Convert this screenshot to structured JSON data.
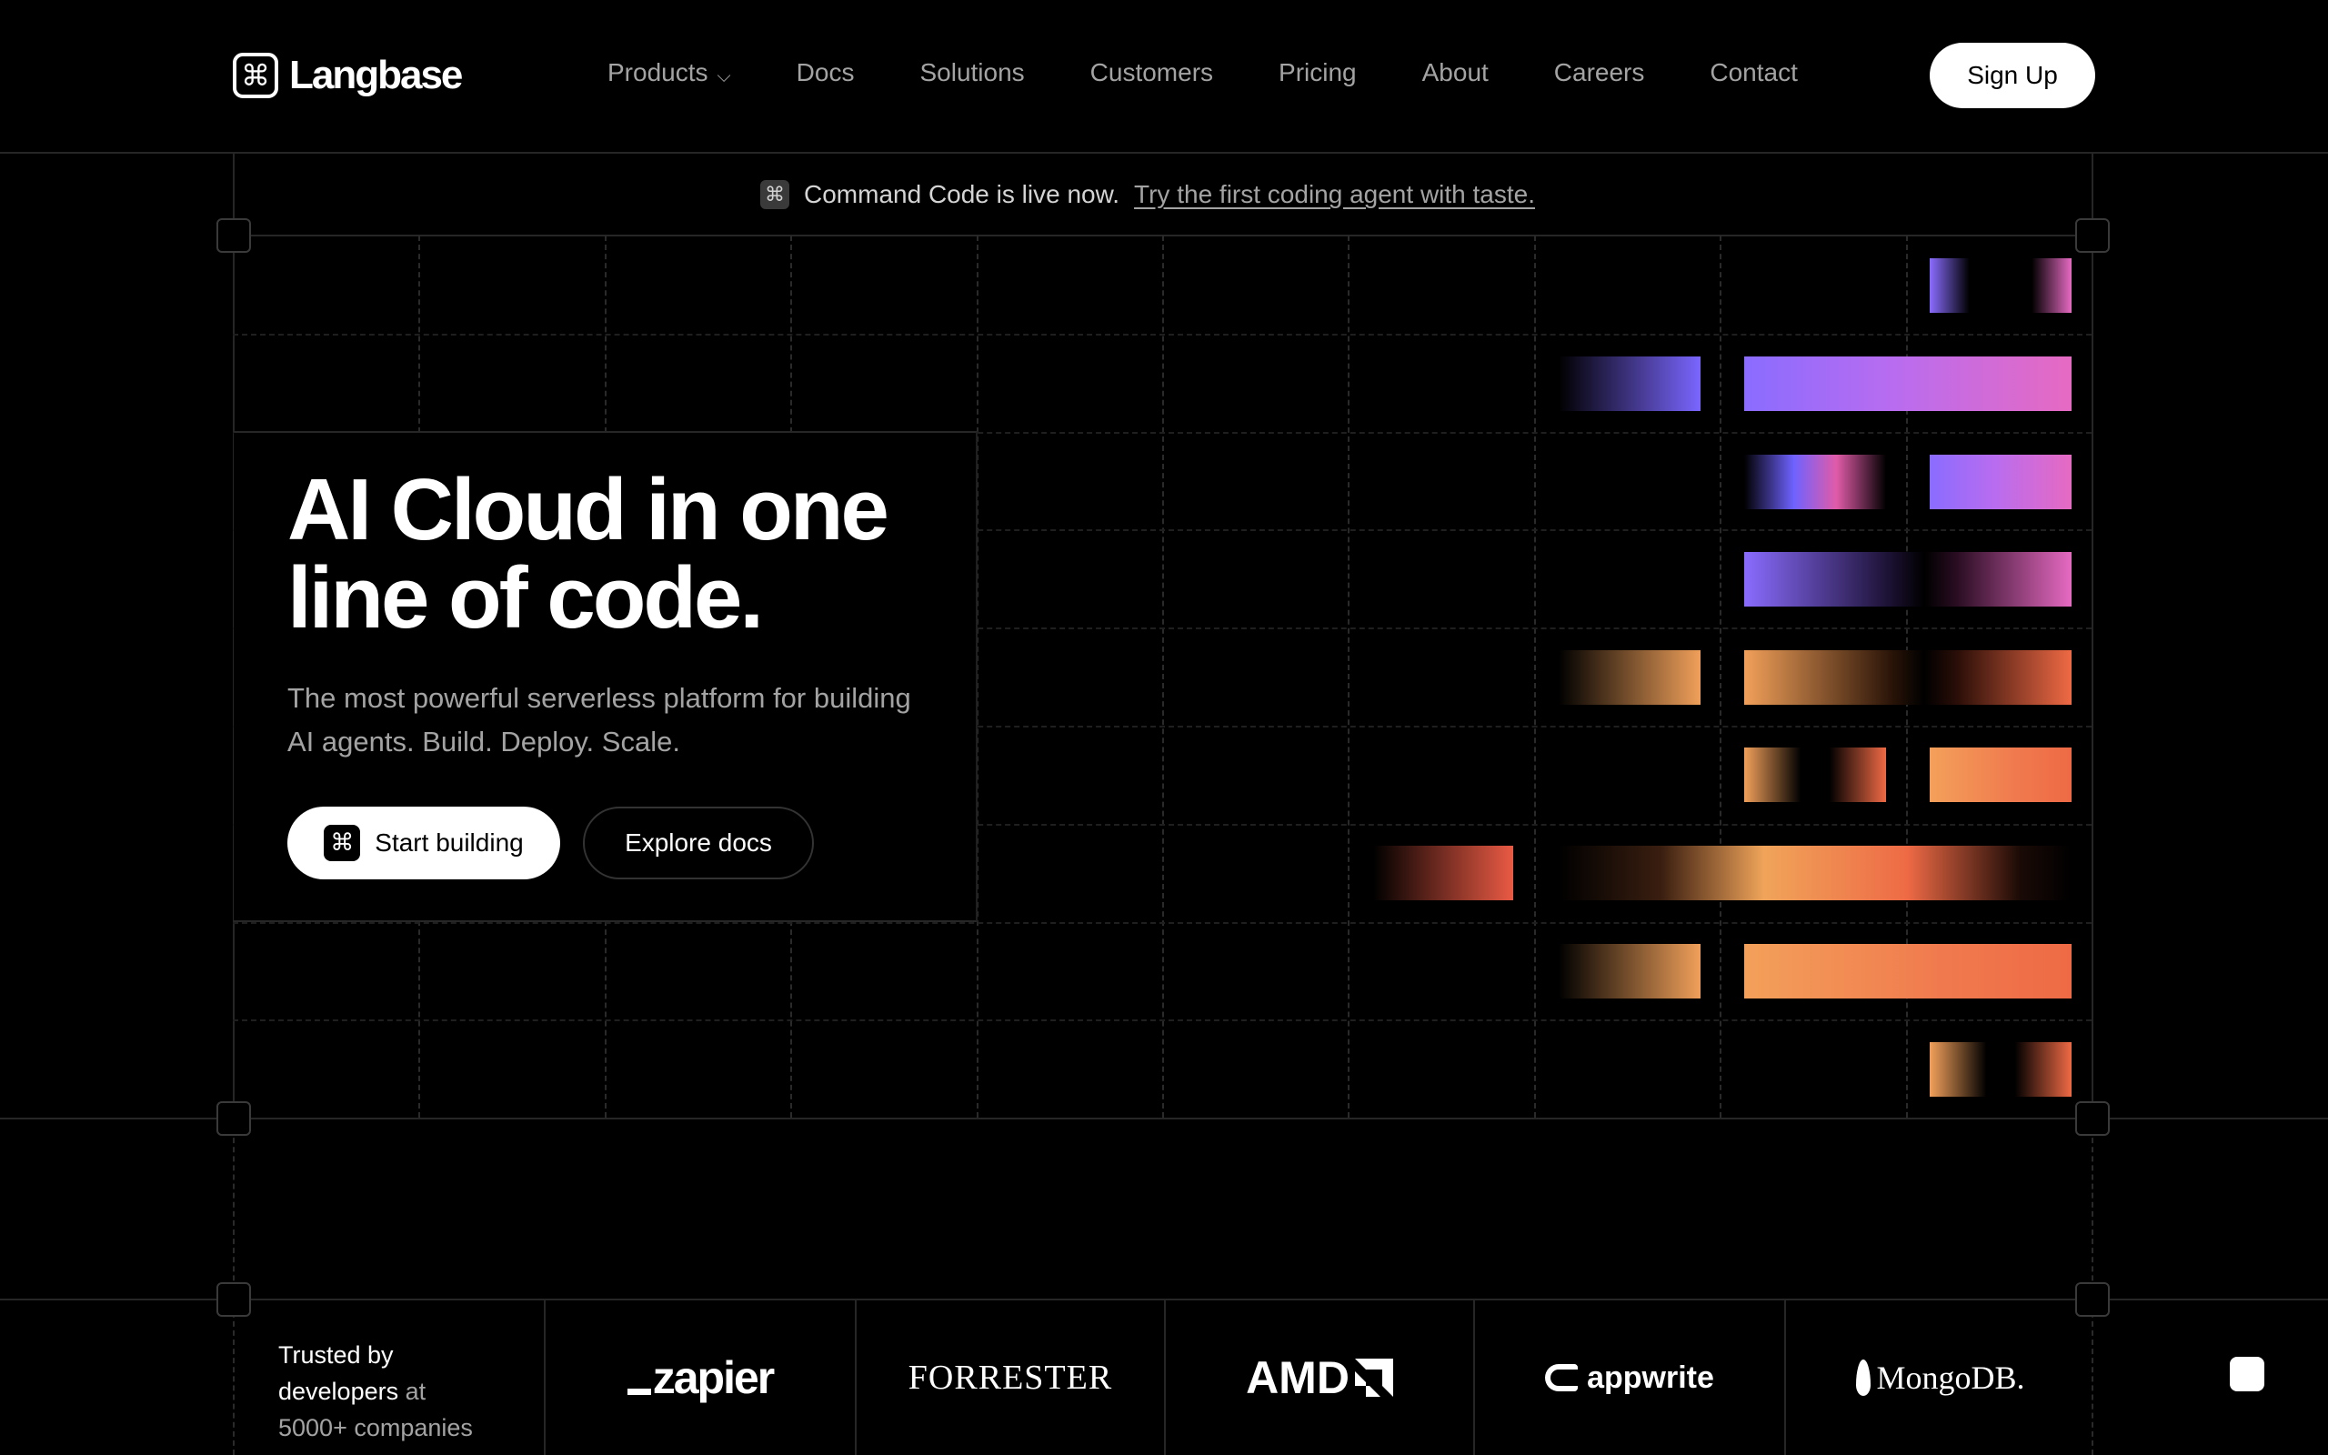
{
  "header": {
    "logo_text": "Langbase",
    "nav": [
      {
        "label": "Products",
        "has_dropdown": true
      },
      {
        "label": "Docs"
      },
      {
        "label": "Solutions"
      },
      {
        "label": "Customers"
      },
      {
        "label": "Pricing"
      },
      {
        "label": "About"
      },
      {
        "label": "Careers"
      },
      {
        "label": "Contact"
      }
    ],
    "signup_label": "Sign Up"
  },
  "announcement": {
    "text": "Command Code is live now.",
    "link": "Try the first coding agent with taste."
  },
  "hero": {
    "title": "AI Cloud in one line of code.",
    "subtitle": "The most powerful serverless platform for building AI agents. Build. Deploy. Scale.",
    "primary_cta": "Start building",
    "secondary_cta": "Explore docs"
  },
  "trusted": {
    "lead": "Trusted by",
    "highlight": "developers",
    "connector": "at",
    "count": "5000+ companies",
    "logos": [
      "zapier",
      "FORRESTER",
      "AMD",
      "appwrite",
      "MongoDB."
    ]
  },
  "icons": {
    "logo": "command-key-icon",
    "announcement": "command-key-icon",
    "cta": "command-key-icon",
    "dropdown": "chevron-down-icon"
  },
  "colors": {
    "background": "#000000",
    "purple": "#8a6cff",
    "pink": "#e66ac2",
    "orange": "#f3a05a",
    "red": "#ee6a45"
  }
}
